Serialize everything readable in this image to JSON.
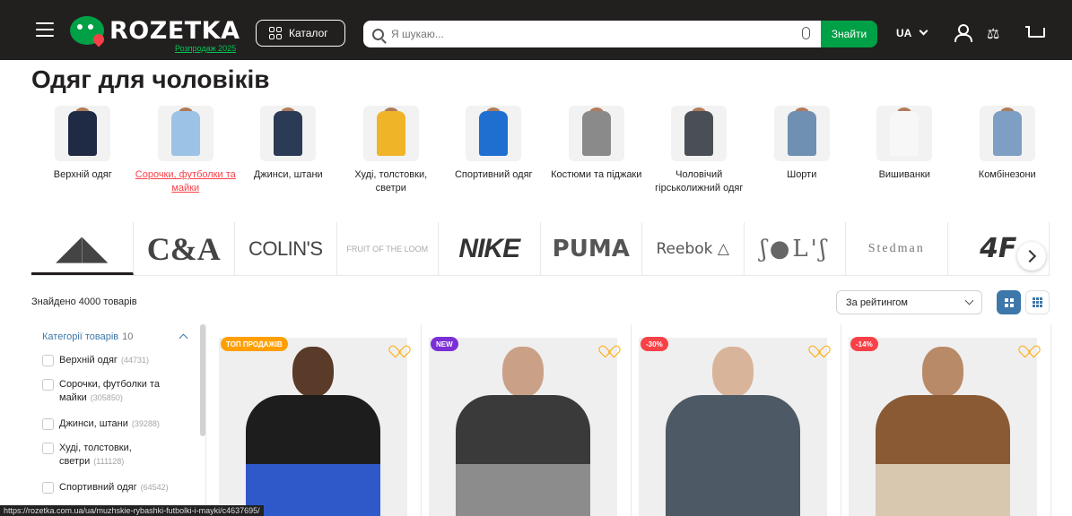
{
  "header": {
    "logo_text": "ROZETKA",
    "logo_sub": "Розпродаж 2025",
    "catalog_label": "Каталог",
    "search_placeholder": "Я шукаю...",
    "find_button": "Знайти",
    "lang": "UA",
    "colors": {
      "bg": "#221f1f",
      "accent": "#00a046"
    }
  },
  "page_title": "Одяг для чоловіків",
  "categories": [
    {
      "label": "Верхній одяг",
      "color": "#1f2a44",
      "active": false
    },
    {
      "label": "Сорочки, футболки та майки",
      "color": "#9cc3e6",
      "active": true
    },
    {
      "label": "Джинси, штани",
      "color": "#2b3a55",
      "active": false
    },
    {
      "label": "Худі, толстовки, светри",
      "color": "#f0b429",
      "active": false
    },
    {
      "label": "Спортивний одяг",
      "color": "#1f6fd1",
      "active": false
    },
    {
      "label": "Костюми та піджаки",
      "color": "#8a8a8a",
      "active": false
    },
    {
      "label": "Чоловічий гірськолижний одяг",
      "color": "#4a4f55",
      "active": false
    },
    {
      "label": "Шорти",
      "color": "#6f8fb3",
      "active": false
    },
    {
      "label": "Вишиванки",
      "color": "#f7f7f7",
      "active": false
    },
    {
      "label": "Комбінезони",
      "color": "#7d9fc4",
      "active": false
    }
  ],
  "brands": [
    {
      "name": "adidas",
      "text": "◢◣",
      "cls": "b-adidas",
      "selected": true
    },
    {
      "name": "c-and-a",
      "text": "C&A",
      "cls": "b-ca",
      "selected": false
    },
    {
      "name": "colins",
      "text": "COLIN'S",
      "cls": "b-colins",
      "selected": false
    },
    {
      "name": "fruit-of-the-loom",
      "text": "FRUIT OF THE LOOM",
      "cls": "b-fruit",
      "selected": false
    },
    {
      "name": "nike",
      "text": "NIKE",
      "cls": "b-nike",
      "selected": false
    },
    {
      "name": "puma",
      "text": "PUMA",
      "cls": "b-puma",
      "selected": false
    },
    {
      "name": "reebok",
      "text": "Reebok △",
      "cls": "b-reebok",
      "selected": false
    },
    {
      "name": "solis",
      "text": "ʃ●L'ʃ",
      "cls": "b-soli",
      "selected": false
    },
    {
      "name": "stedman",
      "text": "Stedman",
      "cls": "b-stedman",
      "selected": false
    },
    {
      "name": "4f",
      "text": "4F",
      "cls": "b-4f",
      "selected": false
    }
  ],
  "found_text": "Знайдено 4000 товарів",
  "sort_value": "За рейтингом",
  "sidebar": {
    "title": "Категорії товарів",
    "count": "10",
    "items": [
      {
        "label": "Верхній одяг",
        "count": "(44731)"
      },
      {
        "label": "Сорочки, футболки та майки",
        "count": "(305850)"
      },
      {
        "label": "Джинси, штани",
        "count": "(39288)"
      },
      {
        "label": "Худі, толстовки, светри",
        "count": "(111128)"
      },
      {
        "label": "Спортивний одяг",
        "count": "(64542)"
      }
    ]
  },
  "products": [
    {
      "badge": "ТОП ПРОДАЖІВ",
      "badge_color": "#ff9f00",
      "jacket": "#1d1d1d",
      "jacket2": "#2f58c9",
      "skin": "#5a3a28"
    },
    {
      "badge": "NEW",
      "badge_color": "#7b2fd6",
      "jacket": "#3a3a3a",
      "jacket2": "#8c8c8c",
      "skin": "#caa186"
    },
    {
      "badge": "-30%",
      "badge_color": "#f84147",
      "jacket": "#4d5964",
      "jacket2": "#4d5964",
      "skin": "#d8b49a"
    },
    {
      "badge": "-14%",
      "badge_color": "#f84147",
      "jacket": "#8a5a34",
      "jacket2": "#d8c8b0",
      "skin": "#b98a68"
    }
  ],
  "status_url": "https://rozetka.com.ua/ua/muzhskie-rybashki-futbolki-i-mayki/c4637695/"
}
